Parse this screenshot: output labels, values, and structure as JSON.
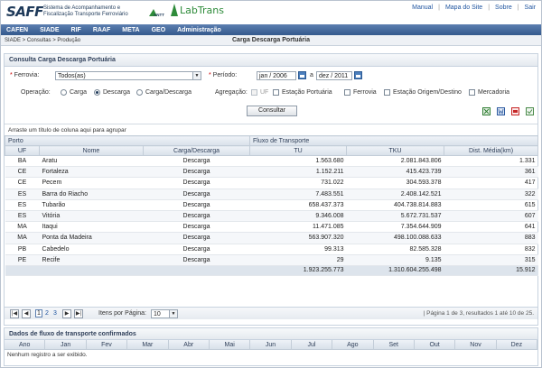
{
  "header": {
    "logo": "SAFF",
    "logo_subtitle": "Sistema de Acompanhamento e Fiscalização Transporte Ferroviário",
    "partner1": "ANTT",
    "partner2": "LabTrans",
    "links": [
      "Manual",
      "Mapa do Site",
      "Sobre",
      "Sair"
    ]
  },
  "menu": [
    "CAFEN",
    "SIADE",
    "RIF",
    "RAAF",
    "META",
    "GEO",
    "Administração"
  ],
  "breadcrumb": "SIADE > Consultas > Produção",
  "page_title": "Carga Descarga Portuária",
  "panel": {
    "title": "Consulta Carga Descarga Portuária",
    "ferrovia_label": "Ferrovia:",
    "ferrovia_value": "Todos(as)",
    "periodo_label": "Período:",
    "periodo_start": "jan / 2006",
    "periodo_sep": "a",
    "periodo_end": "dez / 2011",
    "operacao_label": "Operação:",
    "operacao_options": [
      "Carga",
      "Descarga",
      "Carga/Descarga"
    ],
    "operacao_selected": "Descarga",
    "agregacao_label": "Agregação:",
    "agregacao_options": [
      "UF",
      "Estação Portuária",
      "Ferrovia",
      "Estação Origem/Destino",
      "Mercadoria"
    ],
    "consultar_label": "Consultar",
    "group_hint": "Arraste um título de coluna aqui para agrupar"
  },
  "grid": {
    "group_porto": "Porto",
    "group_fluxo": "Fluxo de Transporte",
    "columns": [
      "UF",
      "Nome",
      "Carga/Descarga",
      "TU",
      "TKU",
      "Dist. Média(km)"
    ],
    "rows": [
      [
        "BA",
        "Aratu",
        "Descarga",
        "1.563.680",
        "2.081.843.806",
        "1.331"
      ],
      [
        "CE",
        "Fortaleza",
        "Descarga",
        "1.152.211",
        "415.423.739",
        "361"
      ],
      [
        "CE",
        "Pecem",
        "Descarga",
        "731.022",
        "304.593.378",
        "417"
      ],
      [
        "ES",
        "Barra do Riacho",
        "Descarga",
        "7.483.551",
        "2.408.142.521",
        "322"
      ],
      [
        "ES",
        "Tubarão",
        "Descarga",
        "658.437.373",
        "404.738.814.883",
        "615"
      ],
      [
        "ES",
        "Vitória",
        "Descarga",
        "9.346.008",
        "5.672.731.537",
        "607"
      ],
      [
        "MA",
        "Itaqui",
        "Descarga",
        "11.471.085",
        "7.354.644.909",
        "641"
      ],
      [
        "MA",
        "Ponta da Madeira",
        "Descarga",
        "563.907.320",
        "498.100.088.633",
        "883"
      ],
      [
        "PB",
        "Cabedelo",
        "Descarga",
        "99.313",
        "82.585.328",
        "832"
      ],
      [
        "PE",
        "Recife",
        "Descarga",
        "29",
        "9.135",
        "315"
      ]
    ],
    "totals": [
      "1.923.255.773",
      "1.310.604.255.498",
      "15.912"
    ]
  },
  "pager": {
    "first": "|◀",
    "prev": "◀",
    "pages": [
      "1",
      "2",
      "3"
    ],
    "current": "1",
    "next": "▶",
    "last": "▶|",
    "per_page_label": "Itens por Página:",
    "per_page_value": "10",
    "info": "| Página 1 de 3, resultados 1 até 10 de 25."
  },
  "panel2": {
    "title": "Dados de fluxo de transporte confirmados",
    "months": [
      "Ano",
      "Jan",
      "Fev",
      "Mar",
      "Abr",
      "Mai",
      "Jun",
      "Jul",
      "Ago",
      "Set",
      "Out",
      "Nov",
      "Dez"
    ],
    "empty": "Nenhum registro a ser exibido."
  },
  "colors": {
    "menu": "#34598c",
    "accent": "#2055a0",
    "brand_green": "#2e8b3a"
  }
}
